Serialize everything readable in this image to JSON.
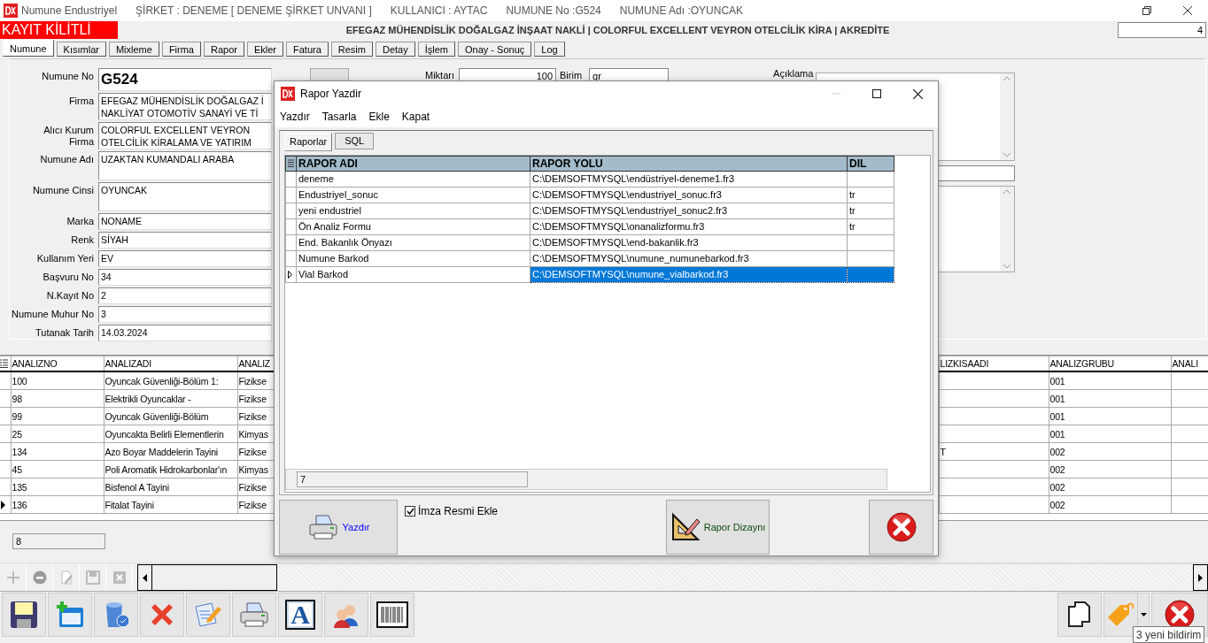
{
  "window": {
    "title_parts": [
      "Numune Endustriyel",
      "ŞİRKET : DENEME [ DENEME ŞİRKET UNVANI ]",
      "KULLANICI : AYTAC",
      "NUMUNE No :G524",
      "NUMUNE Adı :OYUNCAK"
    ]
  },
  "lock_banner": "KAYIT KİLİTLİ",
  "header_info": "EFEGAZ MÜHENDİSLİK DOĞALGAZ İNŞAAT NAKLİ | COLORFUL EXCELLENT VEYRON OTELCİLİK KİRA | AKREDİTE",
  "record_counter": "4",
  "tabs": [
    {
      "label": "Numune",
      "selected": true
    },
    {
      "label": "Kısımlar",
      "selected": false
    },
    {
      "label": "Mixleme",
      "selected": false
    },
    {
      "label": "Firma",
      "selected": false
    },
    {
      "label": "Rapor",
      "selected": false
    },
    {
      "label": "Ekler",
      "selected": false
    },
    {
      "label": "Fatura",
      "selected": false
    },
    {
      "label": "Resim",
      "selected": false
    },
    {
      "label": "Detay",
      "selected": false
    },
    {
      "label": "İşlem",
      "selected": false
    },
    {
      "label": "Onay - Sonuç",
      "selected": false
    },
    {
      "label": "Log",
      "selected": false
    }
  ],
  "form": {
    "fields": [
      {
        "label": "Numune No",
        "kind": "code",
        "lines": [
          "G524"
        ]
      },
      {
        "label": "Firma",
        "kind": "double",
        "lines": [
          "EFEGAZ MÜHENDİSLİK DOĞALGAZ İ",
          "NAKLİYAT OTOMOTİV SANAYİ VE Tİ"
        ]
      },
      {
        "label": "Alıcı Kurum Firma",
        "kind": "double",
        "lines": [
          "COLORFUL EXCELLENT VEYRON",
          "OTELCİLİK KİRALAMA VE YATIRIM"
        ]
      },
      {
        "label": "Numune Adı",
        "kind": "tall",
        "lines": [
          "UZAKTAN KUMANDALI ARABA"
        ]
      },
      {
        "label": "Numune Cinsi",
        "kind": "tall",
        "lines": [
          "OYUNCAK"
        ]
      },
      {
        "label": "Marka",
        "kind": "line",
        "lines": [
          "NONAME"
        ]
      },
      {
        "label": "Renk",
        "kind": "line",
        "lines": [
          "SİYAH"
        ]
      },
      {
        "label": "Kullanım Yeri",
        "kind": "line",
        "lines": [
          "EV"
        ]
      },
      {
        "label": "Başvuru No",
        "kind": "line",
        "lines": [
          "34"
        ]
      },
      {
        "label": "N.Kayıt No",
        "kind": "line",
        "lines": [
          "2"
        ]
      },
      {
        "label": "Numune Muhur No",
        "kind": "line",
        "lines": [
          "3"
        ]
      },
      {
        "label": "Tutanak Tarih",
        "kind": "line",
        "lines": [
          "14.03.2024"
        ]
      }
    ],
    "quantity": {
      "label": "Miktarı",
      "value": "100"
    },
    "unit": {
      "label": "Birim",
      "value": "gr"
    },
    "notes": {
      "label": "Açıklama"
    }
  },
  "analysis_grid": {
    "columns": [
      "ANALIZNO",
      "ANALIZADI",
      "ANALIZ",
      "LIZKISAADI",
      "ANALIZGRUBU",
      "ANALI"
    ],
    "rows": [
      {
        "analizno": "100",
        "analizadi": "Oyuncak Güvenliği-Bölüm 1:",
        "column_3": "Fizikse",
        "analizgrubu": "001",
        "selected": false
      },
      {
        "analizno": "98",
        "analizadi": "Elektrikli Oyuncaklar -",
        "column_3": "Fizikse",
        "analizgrubu": "001",
        "selected": false
      },
      {
        "analizno": "99",
        "analizadi": "Oyuncak Güvenliği-Bölüm",
        "column_3": "Fizikse",
        "analizgrubu": "001",
        "selected": false
      },
      {
        "analizno": "25",
        "analizadi": "Oyuncakta Belirli Elementlerin",
        "column_3": "Kimyas",
        "analizgrubu": "001",
        "selected": false
      },
      {
        "analizno": "134",
        "analizadi": "Azo Boyar Maddelerin Tayini",
        "column_3": "Fizikse",
        "column_4": "T",
        "analizgrubu": "002",
        "selected": false
      },
      {
        "analizno": "45",
        "analizadi": "Poli Aromatik Hidrokarbonlar'ın",
        "column_3": "Kimyas",
        "analizgrubu": "002",
        "selected": false
      },
      {
        "analizno": "135",
        "analizadi": "Bisfenol A Tayini",
        "column_3": "Fizikse",
        "analizgrubu": "002",
        "selected": false
      },
      {
        "analizno": "136",
        "analizadi": "Fitalat Tayini",
        "column_3": "Fizikse",
        "analizgrubu": "002",
        "selected": true
      }
    ],
    "count": "8"
  },
  "toolbar": {
    "font_glyph": "A"
  },
  "notification_tooltip": "3 yeni bildirim",
  "dialog": {
    "title": "Rapor Yazdir",
    "menu": [
      "Yazdır",
      "Tasarla",
      "Ekle",
      "Kapat"
    ],
    "tabs": [
      {
        "label": "Raporlar",
        "selected": true
      },
      {
        "label": "SQL",
        "selected": false
      }
    ],
    "columns": [
      "RAPOR ADI",
      "RAPOR YOLU",
      "DIL"
    ],
    "rows": [
      {
        "name": "deneme",
        "path": "C:\\DEMSOFTMYSQL\\endüstriyel-deneme1.fr3",
        "selected": false
      },
      {
        "name": "Endustriyel_sonuc",
        "path": "C:\\DEMSOFTMYSQL\\endustriyel_sonuc.fr3",
        "lang": "tr",
        "selected": false
      },
      {
        "name": "yeni endustriel",
        "path": "C:\\DEMSOFTMYSQL\\endustriyel_sonuc2.fr3",
        "lang": "tr",
        "selected": false
      },
      {
        "name": "Ön Analiz Formu",
        "path": "C:\\DEMSOFTMYSQL\\onanalizformu.fr3",
        "lang": "tr",
        "selected": false
      },
      {
        "name": "End. Bakanlık Önyazı",
        "path": "C:\\DEMSOFTMYSQL\\end-bakanlik.fr3",
        "selected": false
      },
      {
        "name": "Numune Barkod",
        "path": "C:\\DEMSOFTMYSQL\\numune_numunebarkod.fr3",
        "selected": false
      },
      {
        "name": "Vial Barkod",
        "path": "C:\\DEMSOFTMYSQL\\numune_vialbarkod.fr3",
        "selected": true
      }
    ],
    "count": "7",
    "print_button": "Yazdır",
    "signature_checkbox": {
      "label": "İmza Resmi Ekle",
      "checked": true
    },
    "design_button": "Rapor Dizaynı"
  }
}
